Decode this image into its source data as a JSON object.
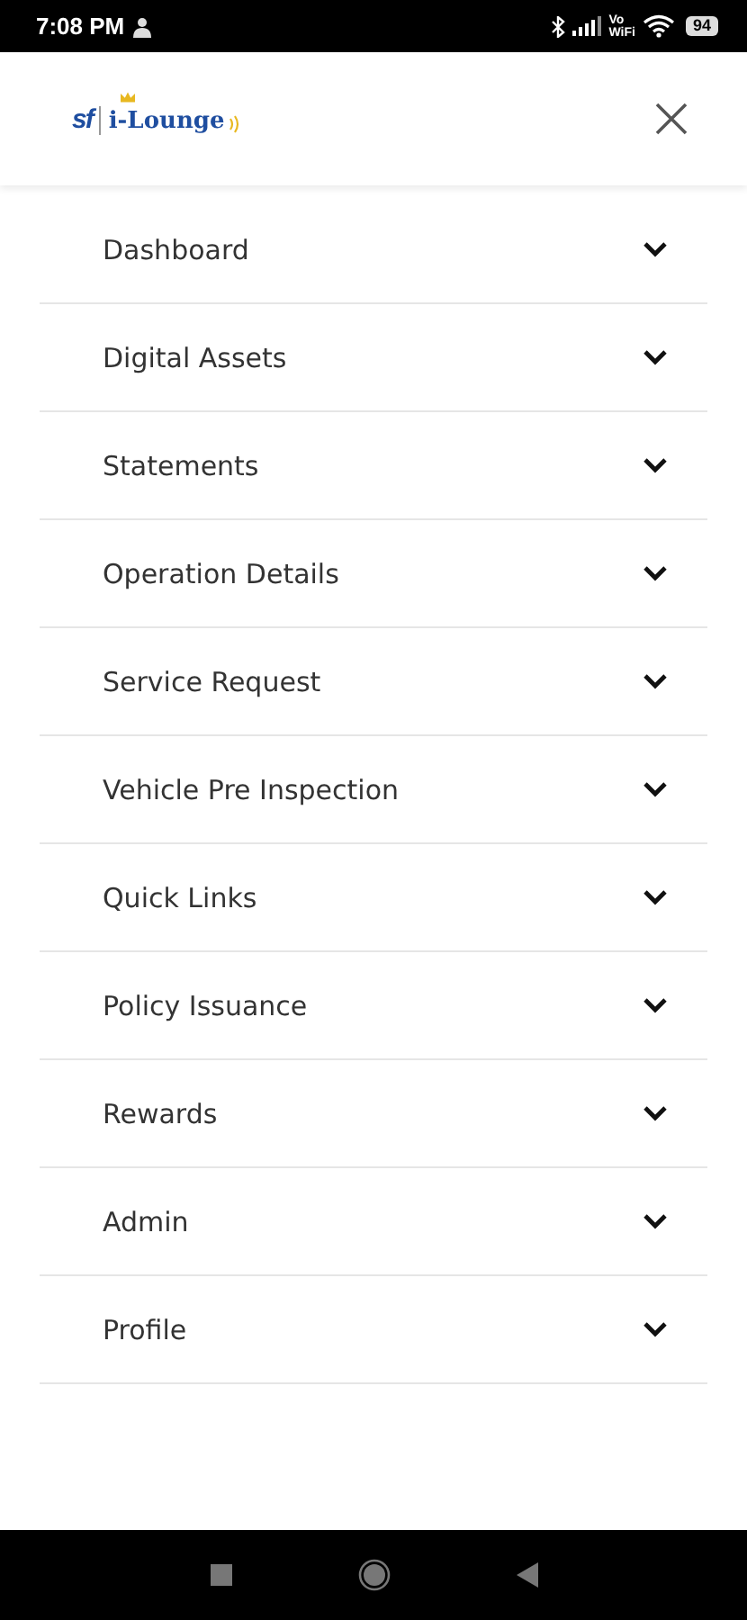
{
  "status_bar": {
    "time": "7:08 PM",
    "vowifi_top": "Vo",
    "vowifi_bottom": "WiFi",
    "battery": "94"
  },
  "header": {
    "logo_mark": "sf",
    "logo_text": "i-Lounge"
  },
  "menu": [
    {
      "label": "Dashboard",
      "expanded": false
    },
    {
      "label": "Digital Assets",
      "expanded": false
    },
    {
      "label": "Statements",
      "expanded": false
    },
    {
      "label": "Operation Details",
      "expanded": false
    },
    {
      "label": "Service Request",
      "expanded": false
    },
    {
      "label": "Vehicle Pre Inspection",
      "expanded": false
    },
    {
      "label": "Quick Links",
      "expanded": false
    },
    {
      "label": "Policy Issuance",
      "expanded": false
    },
    {
      "label": "Rewards",
      "expanded": false
    },
    {
      "label": "Admin",
      "expanded": false
    },
    {
      "label": "Profile",
      "expanded": false
    }
  ]
}
